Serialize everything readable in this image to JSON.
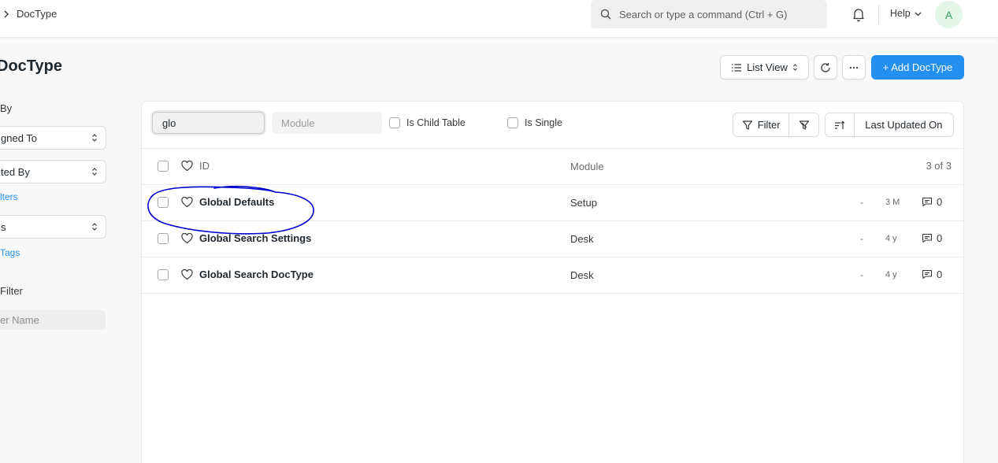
{
  "navbar": {
    "breadcrumb": "DocType",
    "search_placeholder": "Search or type a command (Ctrl + G)",
    "help_label": "Help",
    "avatar_initial": "A"
  },
  "page": {
    "title": "DocType",
    "list_view_label": "List View",
    "add_button_label": "+ Add DocType"
  },
  "sidebar": {
    "group_by_label": "By",
    "assigned_to": "gned To",
    "created_by": "ted By",
    "edit_filters": "lters",
    "tags_select": "s",
    "show_tags": "Tags",
    "save_filter_label": "Filter",
    "filter_name_placeholder": "er Name"
  },
  "filters": {
    "id_value": "glo",
    "module_placeholder": "Module",
    "is_child_table": "Is Child Table",
    "is_single": "Is Single",
    "filter_label": "Filter",
    "sort_label": "Last Updated On"
  },
  "list": {
    "header": {
      "id": "ID",
      "module": "Module",
      "count": "3 of 3"
    },
    "rows": [
      {
        "title": "Global Defaults",
        "module": "Setup",
        "modified": "-",
        "age": "3 M",
        "comments": "0"
      },
      {
        "title": "Global Search Settings",
        "module": "Desk",
        "modified": "-",
        "age": "4 y",
        "comments": "0"
      },
      {
        "title": "Global Search DocType",
        "module": "Desk",
        "modified": "-",
        "age": "4 y",
        "comments": "0"
      }
    ]
  },
  "colors": {
    "primary": "#2490ef",
    "annotation": "#0000cc",
    "avatar_bg": "#e4f5e9",
    "avatar_fg": "#38a160"
  }
}
